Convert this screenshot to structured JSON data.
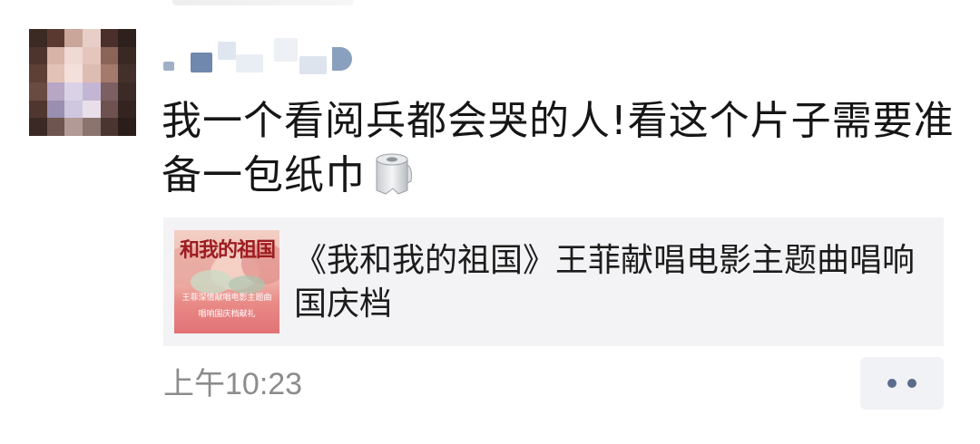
{
  "post": {
    "text": "我一个看阅兵都会哭的人!看这个片子需要准备一包纸巾",
    "emoji_icon": "toilet-paper-icon"
  },
  "link_card": {
    "title": "《我和我的祖国》王菲献唱电影主题曲唱响国庆档",
    "thumbnail": {
      "title_text": "和我的祖国",
      "subtitle_line1": "王菲深情献唱电影主题曲",
      "subtitle_line2": "唱响国庆档献礼"
    }
  },
  "footer": {
    "timestamp": "上午10:23",
    "more_icon": "more-dots-icon"
  },
  "colors": {
    "text": "#161616",
    "timestamp": "#8c8c8c",
    "card_background": "#f3f3f5",
    "more_dots": "#5b6b8c"
  }
}
